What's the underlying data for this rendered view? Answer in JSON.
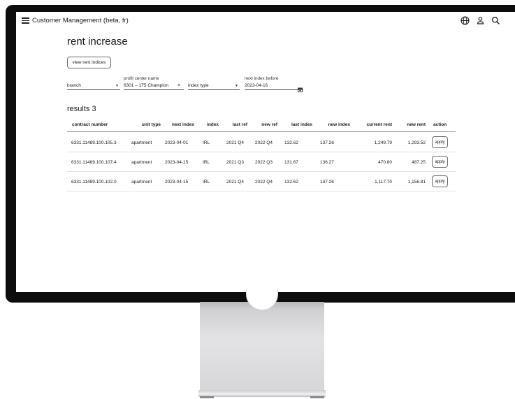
{
  "app": {
    "title": "Customer Management (beta, fr)"
  },
  "page": {
    "title": "rent increase",
    "view_indices_label": "view rent indices"
  },
  "filters": {
    "branch": {
      "label": "",
      "value": "branch"
    },
    "profit_center": {
      "label": "profit center name",
      "value": "6301 – 175 Champion",
      "clear_symbol": "×"
    },
    "index_type": {
      "label": "",
      "value": "index type"
    },
    "next_index_before": {
      "label": "next index before",
      "value": "2023-04-16"
    }
  },
  "results": {
    "label": "results 3",
    "columns": [
      "contract number",
      "unit type",
      "next index",
      "index",
      "last ref",
      "new ref",
      "last index",
      "new index",
      "current rent",
      "new rent",
      "action"
    ],
    "rows": [
      {
        "contract": "6331.11489.100.105.3",
        "unit_type": "apartment",
        "next_index": "2023-04-01",
        "index": "IRL",
        "last_ref": "2021 Q4",
        "new_ref": "2022 Q4",
        "last_index": "132.62",
        "new_index": "137.26",
        "current_rent": "1,249.79",
        "new_rent": "1,293.52",
        "action": "apply"
      },
      {
        "contract": "6331.11489.100.107.4",
        "unit_type": "apartment",
        "next_index": "2023-04-15",
        "index": "IRL",
        "last_ref": "2021 Q3",
        "new_ref": "2022 Q3",
        "last_index": "131.67",
        "new_index": "136.27",
        "current_rent": "470.80",
        "new_rent": "487.25",
        "action": "apply"
      },
      {
        "contract": "6331.11489.100.102.0",
        "unit_type": "apartment",
        "next_index": "2023-04-15",
        "index": "IRL",
        "last_ref": "2021 Q4",
        "new_ref": "2022 Q4",
        "last_index": "132.62",
        "new_index": "137.26",
        "current_rent": "1,117.70",
        "new_rent": "1,156.81",
        "action": "apply"
      }
    ]
  },
  "icons": {
    "menu": "hamburger-menu-icon",
    "language": "globe-icon",
    "account": "user-icon",
    "search": "search-icon",
    "calendar": "calendar-icon",
    "dropdown": "chevron-down-icon"
  },
  "colors": {
    "bezel": "#0d0d0d",
    "text": "#1a1a1a",
    "stand": "#d6d6d8"
  }
}
